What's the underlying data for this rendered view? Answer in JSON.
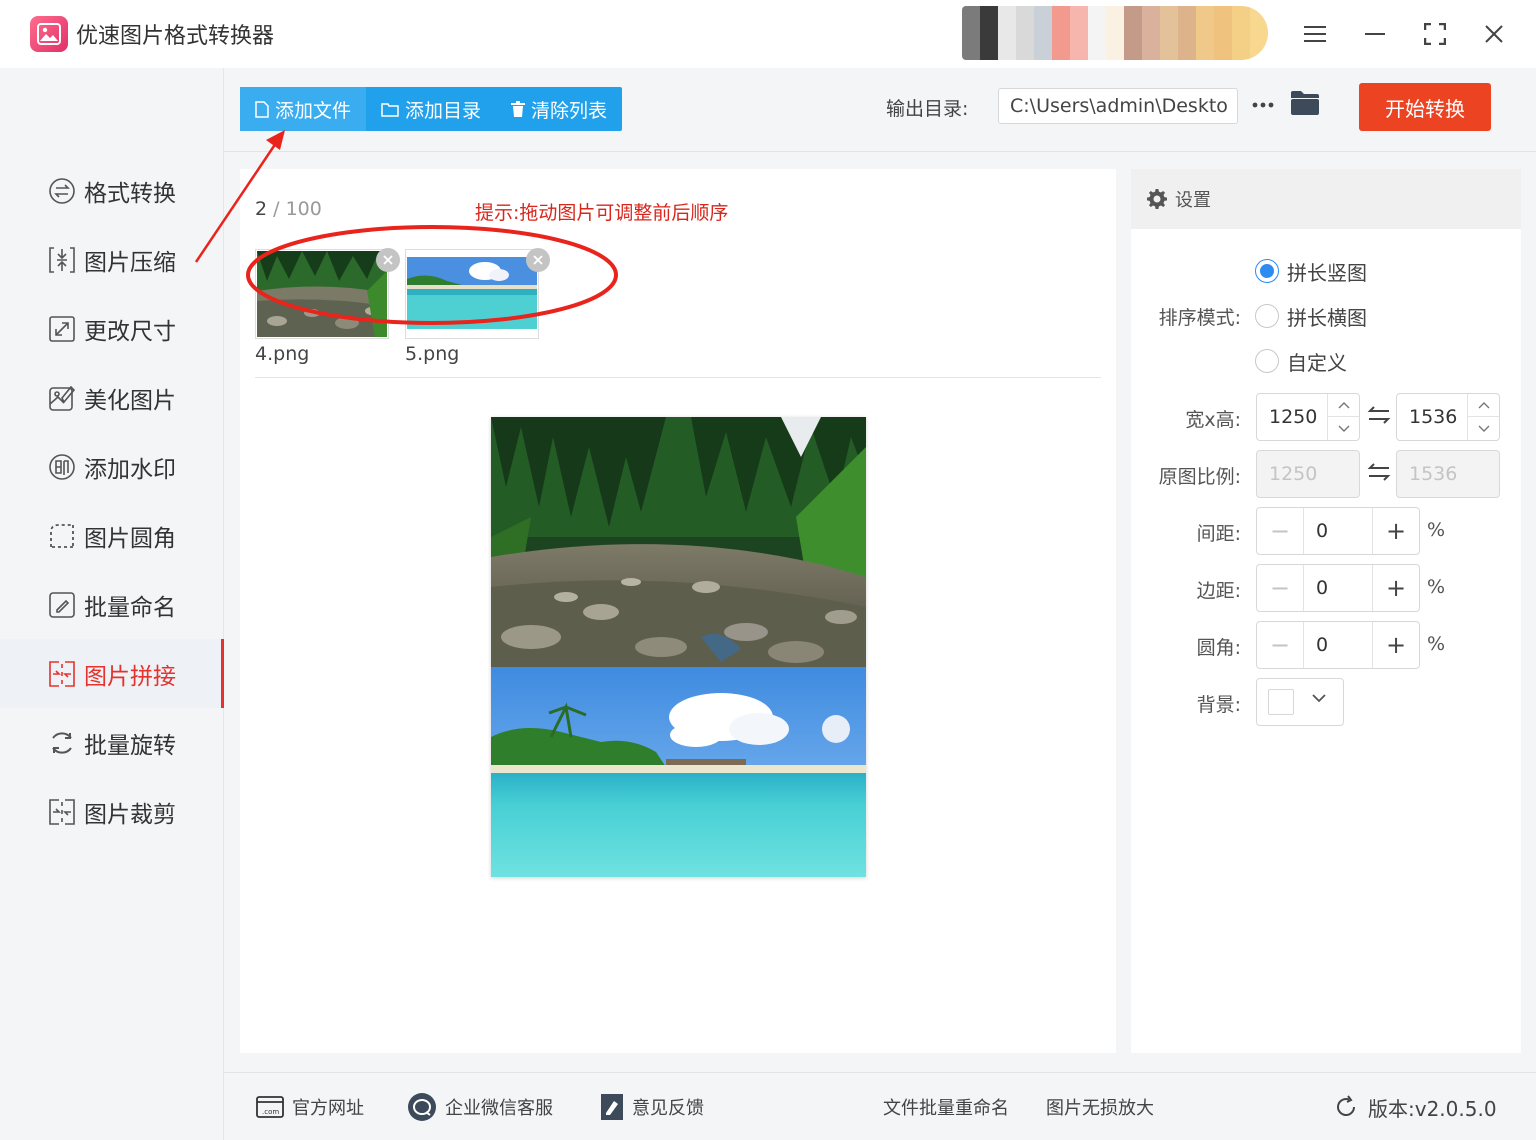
{
  "app": {
    "title": "优速图片格式转换器"
  },
  "window_controls": [
    "menu-icon",
    "minimize-icon",
    "maximize-icon",
    "close-icon"
  ],
  "sidebar": {
    "items": [
      {
        "label": "格式转换",
        "icon": "format-convert-icon",
        "active": false
      },
      {
        "label": "图片压缩",
        "icon": "compress-icon",
        "active": false
      },
      {
        "label": "更改尺寸",
        "icon": "resize-icon",
        "active": false
      },
      {
        "label": "美化图片",
        "icon": "beautify-icon",
        "active": false
      },
      {
        "label": "添加水印",
        "icon": "watermark-icon",
        "active": false
      },
      {
        "label": "图片圆角",
        "icon": "round-corner-icon",
        "active": false
      },
      {
        "label": "批量命名",
        "icon": "rename-icon",
        "active": false
      },
      {
        "label": "图片拼接",
        "icon": "stitch-icon",
        "active": true
      },
      {
        "label": "批量旋转",
        "icon": "rotate-icon",
        "active": false
      },
      {
        "label": "图片裁剪",
        "icon": "crop-icon",
        "active": false
      }
    ]
  },
  "toolbar": {
    "add_file": "添加文件",
    "add_folder": "添加目录",
    "clear_list": "清除列表",
    "output_label": "输出目录:",
    "output_path": "C:\\Users\\admin\\Deskto",
    "more": "···",
    "start": "开始转换"
  },
  "content": {
    "count": "2",
    "count_sep": " / ",
    "count_total": "100",
    "hint": "提示:拖动图片可调整前后顺序",
    "files": [
      {
        "name": "4.png"
      },
      {
        "name": "5.png"
      }
    ]
  },
  "settings": {
    "title": "设置",
    "sort_label": "排序模式:",
    "sort_options": [
      {
        "label": "拼长竖图",
        "checked": true
      },
      {
        "label": "拼长横图",
        "checked": false
      },
      {
        "label": "自定义",
        "checked": false
      }
    ],
    "size_label": "宽x高:",
    "width": "1250",
    "height": "1536",
    "ratio_label": "原图比例:",
    "ratio_width": "1250",
    "ratio_height": "1536",
    "gap_label": "间距:",
    "gap": "0",
    "margin_label": "边距:",
    "margin": "0",
    "radius_label": "圆角:",
    "radius": "0",
    "percent": "%",
    "bg_label": "背景:",
    "bg_color": "#ffffff"
  },
  "footer": {
    "website": "官方网址",
    "wechat": "企业微信客服",
    "feedback": "意见反馈",
    "batch_rename": "文件批量重命名",
    "enlarge": "图片无损放大",
    "version": "版本:v2.0.5.0"
  },
  "colors": {
    "accent_blue": "#21a1ec",
    "accent_red": "#ec4322",
    "active_red": "#e5322d",
    "hint_red": "#d9261c",
    "radio_blue": "#2d8cf0"
  }
}
